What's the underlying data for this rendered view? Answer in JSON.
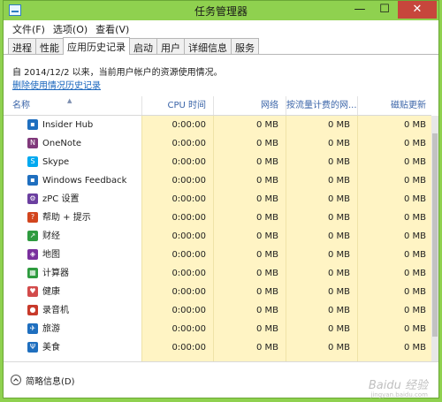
{
  "window": {
    "title": "任务管理器",
    "controls": {
      "minimize": "—",
      "maximize": "☐",
      "close": "✕"
    }
  },
  "menu": [
    "文件(F)",
    "选项(O)",
    "查看(V)"
  ],
  "tabs": [
    {
      "label": "进程",
      "active": false
    },
    {
      "label": "性能",
      "active": false
    },
    {
      "label": "应用历史记录",
      "active": true
    },
    {
      "label": "启动",
      "active": false
    },
    {
      "label": "用户",
      "active": false
    },
    {
      "label": "详细信息",
      "active": false
    },
    {
      "label": "服务",
      "active": false
    }
  ],
  "info_text": "自 2014/12/2 以来，当前用户帐户的资源使用情况。",
  "delete_link": "删除使用情况历史记录",
  "columns": {
    "name": "名称",
    "cpu": "CPU 时间",
    "network": "网络",
    "metered": "按流量计费的网...",
    "tile": "磁贴更新"
  },
  "rows": [
    {
      "name": "Insider Hub",
      "icon": "insider-hub-icon",
      "color": "#1f6fbf",
      "glyph": "▪",
      "cpu": "0:00:00",
      "network": "0 MB",
      "metered": "0 MB",
      "tile": "0 MB"
    },
    {
      "name": "OneNote",
      "icon": "onenote-icon",
      "color": "#80397b",
      "glyph": "N",
      "cpu": "0:00:00",
      "network": "0 MB",
      "metered": "0 MB",
      "tile": "0 MB"
    },
    {
      "name": "Skype",
      "icon": "skype-icon",
      "color": "#00a9f0",
      "glyph": "S",
      "cpu": "0:00:00",
      "network": "0 MB",
      "metered": "0 MB",
      "tile": "0 MB"
    },
    {
      "name": "Windows Feedback",
      "icon": "windows-feedback-icon",
      "color": "#1f6fbf",
      "glyph": "▪",
      "cpu": "0:00:00",
      "network": "0 MB",
      "metered": "0 MB",
      "tile": "0 MB"
    },
    {
      "name": "zPC 设置",
      "icon": "pc-settings-icon",
      "color": "#6b3fa0",
      "glyph": "⚙",
      "cpu": "0:00:00",
      "network": "0 MB",
      "metered": "0 MB",
      "tile": "0 MB"
    },
    {
      "name": "帮助 + 提示",
      "icon": "help-tips-icon",
      "color": "#d2451e",
      "glyph": "?",
      "cpu": "0:00:00",
      "network": "0 MB",
      "metered": "0 MB",
      "tile": "0 MB"
    },
    {
      "name": "财经",
      "icon": "finance-icon",
      "color": "#2e9b3f",
      "glyph": "↗",
      "cpu": "0:00:00",
      "network": "0 MB",
      "metered": "0 MB",
      "tile": "0 MB"
    },
    {
      "name": "地图",
      "icon": "maps-icon",
      "color": "#7a2f9e",
      "glyph": "◈",
      "cpu": "0:00:00",
      "network": "0 MB",
      "metered": "0 MB",
      "tile": "0 MB"
    },
    {
      "name": "计算器",
      "icon": "calculator-icon",
      "color": "#2e9b3f",
      "glyph": "▦",
      "cpu": "0:00:00",
      "network": "0 MB",
      "metered": "0 MB",
      "tile": "0 MB"
    },
    {
      "name": "健康",
      "icon": "health-icon",
      "color": "#d24b4b",
      "glyph": "♥",
      "cpu": "0:00:00",
      "network": "0 MB",
      "metered": "0 MB",
      "tile": "0 MB"
    },
    {
      "name": "录音机",
      "icon": "recorder-icon",
      "color": "#c83a2b",
      "glyph": "●",
      "cpu": "0:00:00",
      "network": "0 MB",
      "metered": "0 MB",
      "tile": "0 MB"
    },
    {
      "name": "旅游",
      "icon": "travel-icon",
      "color": "#1f6fbf",
      "glyph": "✈",
      "cpu": "0:00:00",
      "network": "0 MB",
      "metered": "0 MB",
      "tile": "0 MB"
    },
    {
      "name": "美食",
      "icon": "food-icon",
      "color": "#1f6fbf",
      "glyph": "Ψ",
      "cpu": "0:00:00",
      "network": "0 MB",
      "metered": "0 MB",
      "tile": "0 MB"
    }
  ],
  "footer": {
    "fewer_details": "简略信息(D)"
  },
  "watermark": {
    "text": "Baidu 经验",
    "sub": "jingyan.baidu.com"
  }
}
